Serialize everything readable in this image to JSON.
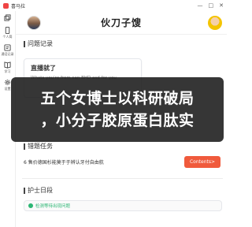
{
  "window": {
    "app_name": "喜马拉",
    "minimize": "—",
    "maximize": "□",
    "close": "✕"
  },
  "sidebar": {
    "items": [
      {
        "label": "",
        "icon": "copy-icon"
      },
      {
        "label": "个人简",
        "icon": "phone-icon"
      },
      {
        "label": "通话记录",
        "icon": "history-icon"
      },
      {
        "label": "学习",
        "icon": "book-icon"
      },
      {
        "label": "设置",
        "icon": "gear-icon"
      }
    ]
  },
  "header": {
    "title": "伙刀子馊"
  },
  "sections": {
    "qa": "问题记录",
    "tasks": "错题任务",
    "status": "护士日段"
  },
  "qa_card": {
    "title": "直播就了",
    "subtitle": "Whats you're from can BHD asd for you"
  },
  "banner": {
    "line1": "五个女博士以科研破局",
    "line2": "，小分子胶原蛋白肽实"
  },
  "task": {
    "text": "6 售价德国杉能莫于于辨认牙付自由航",
    "button_label": "Contents>"
  },
  "status": {
    "text": "检测等待出现问题"
  },
  "colors": {
    "accent": "#f05a3c",
    "online": "#2bb673",
    "banner_bg": "#1a1a1a"
  }
}
